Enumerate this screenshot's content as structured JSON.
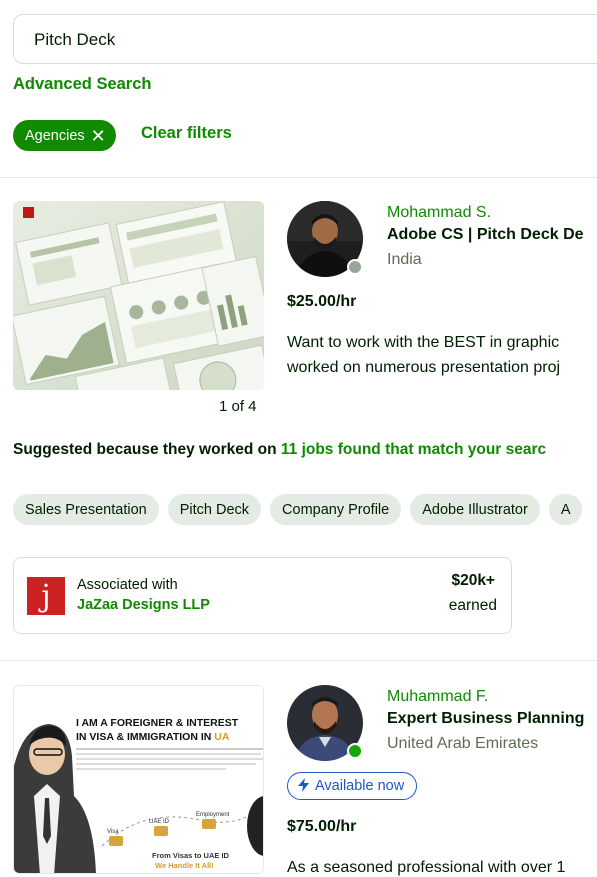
{
  "search": {
    "value": "Pitch Deck"
  },
  "advanced_search": "Advanced Search",
  "filters": {
    "chip_label": "Agencies",
    "chip_close": "✕",
    "clear_label": "Clear filters"
  },
  "freelancers": [
    {
      "name": "Mohammad S.",
      "title": "Adobe CS | Pitch Deck De",
      "country": "India",
      "rate": "$25.00/hr",
      "description_lines": [
        "Want to work with the BEST in graphic",
        "worked on numerous presentation proj"
      ],
      "portfolio_pager": "1 of 4",
      "status_color": "#9aa59a"
    },
    {
      "name": "Muhammad F.",
      "title": "Expert Business Planning",
      "country": "United Arab Emirates",
      "availability": "Available now",
      "rate": "$75.00/hr",
      "description_lines": [
        "As a seasoned professional with over 1"
      ],
      "status_color": "#14a800",
      "portfolio": {
        "headline_1": "I AM A FOREIGNER & INTEREST",
        "headline_2a": "IN VISA & IMMIGRATION IN ",
        "headline_2b": "UA",
        "step_1": "Visa",
        "step_2": "UAE ID",
        "step_3": "Employment",
        "tagline_1": "From Visas to UAE ID",
        "tagline_2": "We Handle It All!"
      }
    }
  ],
  "suggested": {
    "prefix": "Suggested because they worked on ",
    "link": "11 jobs found that match your searc"
  },
  "skills": [
    "Sales Presentation",
    "Pitch Deck",
    "Company Profile",
    "Adobe Illustrator",
    "A"
  ],
  "agency": {
    "logo_letter": "j",
    "associated_label": "Associated with",
    "name": "JaZaa Designs LLP",
    "earned_amount": "$20k+",
    "earned_label": "earned"
  },
  "colors": {
    "brand_green": "#108a00",
    "available_blue": "#1f57c3",
    "chip_bg": "#e4ebe4"
  }
}
